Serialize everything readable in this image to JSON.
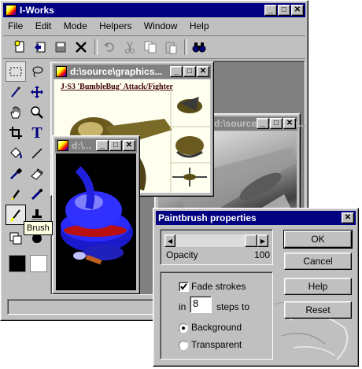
{
  "main_window": {
    "title": "I-Works",
    "menu": [
      "File",
      "Edit",
      "Mode",
      "Helpers",
      "Window",
      "Help"
    ]
  },
  "tooltip": "Brush",
  "doc_window_1": {
    "title": "d:\\source\\graphics...",
    "caption": "J-S3 'BumbleBug' Attack/Fighter"
  },
  "doc_window_2": {
    "title": "d:\\..."
  },
  "doc_window_3": {
    "title": "d:\\source\\graphics..."
  },
  "dialog": {
    "title": "Paintbrush properties",
    "opacity_label": "Opacity",
    "opacity_value": "100",
    "fade_strokes_label": "Fade strokes",
    "fade_strokes_checked": true,
    "in_label": "in",
    "steps_value": "8",
    "steps_label": "steps to",
    "background_label": "Background",
    "transparent_label": "Transparent",
    "fade_target": "Background",
    "ok_label": "OK",
    "cancel_label": "Cancel",
    "help_label": "Help",
    "reset_label": "Reset"
  },
  "icons": {
    "toolbar": [
      "new-icon",
      "open-icon",
      "save-icon",
      "close-icon",
      "undo-icon",
      "cut-icon",
      "copy-icon",
      "paste-icon",
      "find-icon"
    ],
    "tools": [
      "rect-select-icon",
      "lasso-icon",
      "magic-wand-icon",
      "move-icon",
      "hand-icon",
      "zoom-icon",
      "crop-icon",
      "text-icon",
      "fill-icon",
      "line-icon",
      "eyedropper-icon",
      "eraser-icon",
      "pen-icon",
      "clone-icon",
      "brush-icon",
      "stamp-icon"
    ]
  },
  "colors": {
    "titlebar_active": "#000080",
    "titlebar_inactive": "#808080",
    "face": "#c0c0c0",
    "foreground": "#000000",
    "background": "#ffffff"
  }
}
